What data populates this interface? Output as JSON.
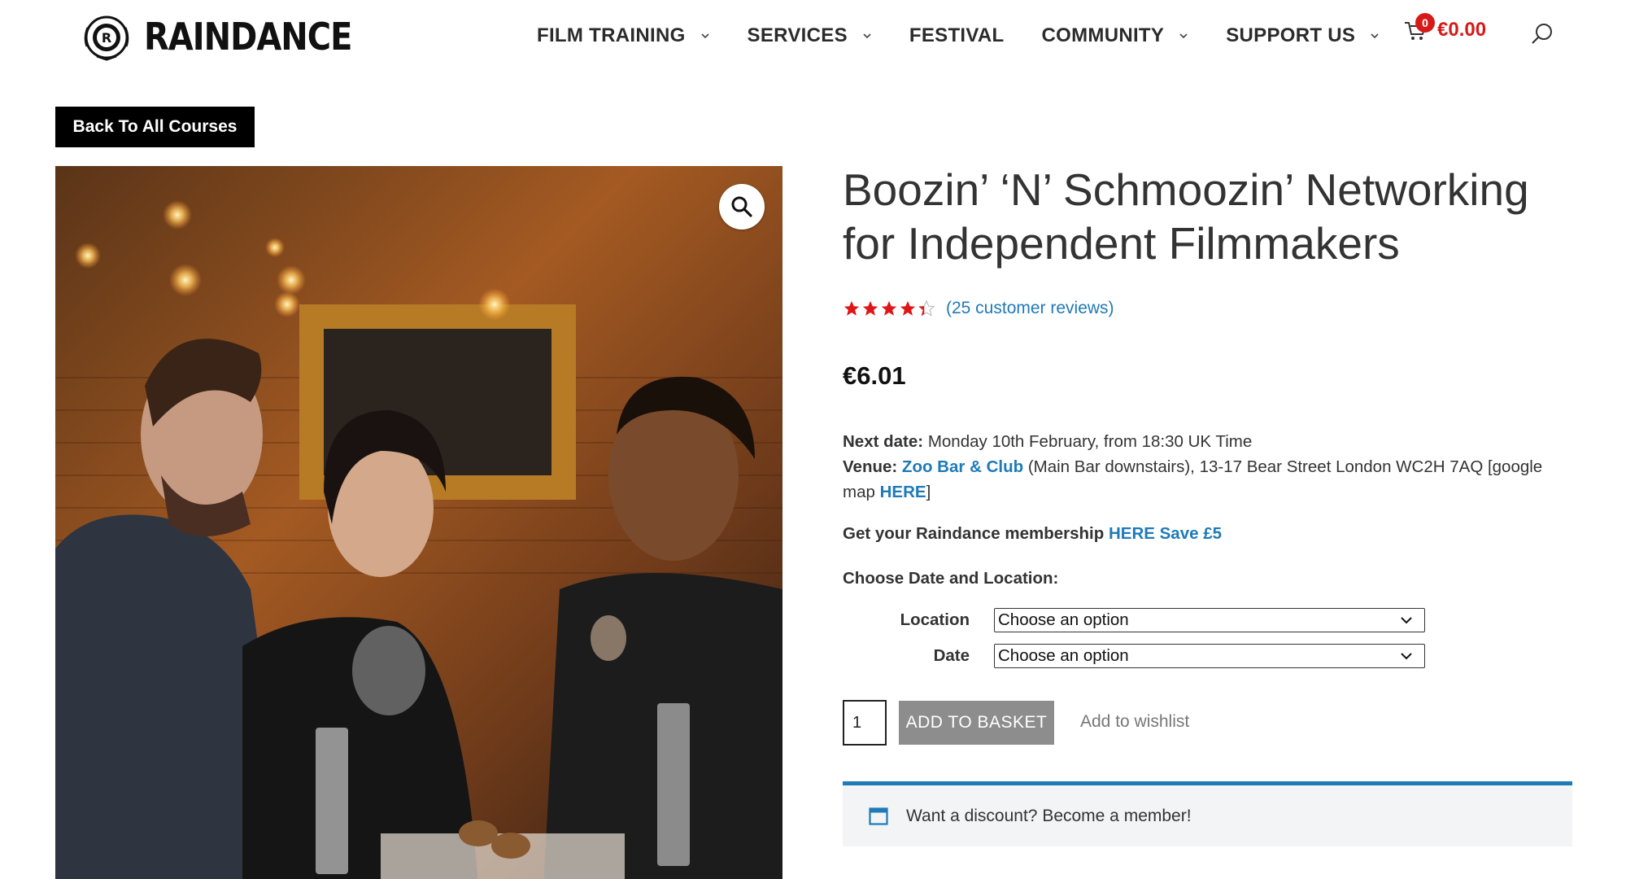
{
  "brand": {
    "name": "RAINDANCE",
    "logo_icon": "raindance-logo-icon"
  },
  "nav": {
    "items": [
      {
        "label": "FILM TRAINING",
        "has_dropdown": true
      },
      {
        "label": "SERVICES",
        "has_dropdown": true
      },
      {
        "label": "FESTIVAL",
        "has_dropdown": false
      },
      {
        "label": "COMMUNITY",
        "has_dropdown": true
      },
      {
        "label": "SUPPORT US",
        "has_dropdown": true
      }
    ],
    "cart": {
      "count": "0",
      "amount": "€0.00",
      "icon": "cart-icon"
    },
    "search_icon": "search-icon"
  },
  "back_button": "Back To All Courses",
  "product": {
    "title": "Boozin’ ‘N’ Schmoozin’ Networking for Independent Filmmakers",
    "rating": 4.3,
    "rating_max": 5,
    "reviews_label": "(25 customer reviews)",
    "price": "€6.01",
    "next_date_label": "Next date:",
    "next_date_value": "Monday 10th February, from 18:30 UK Time",
    "venue_label": "Venue:",
    "venue_link": "Zoo Bar & Club",
    "venue_text": "(Main Bar downstairs), 13-17 Bear Street London WC2H 7AQ [google map",
    "venue_map_link": "HERE",
    "venue_end": "]",
    "membership_text": "Get your Raindance membership",
    "membership_link": "HERE Save £5",
    "choose_label": "Choose Date and Location:",
    "variations": [
      {
        "label": "Location",
        "value": "Choose an option"
      },
      {
        "label": "Date",
        "value": "Choose an option"
      }
    ],
    "quantity": "1",
    "add_to_basket": "ADD TO BASKET",
    "wishlist": "Add to wishlist",
    "notice": "Want a discount? Become a member!"
  },
  "colors": {
    "accent": "#1f7ab8",
    "cart_red": "#d61a1a",
    "star_red": "#e01515",
    "button_grey": "#8d8d8d"
  }
}
